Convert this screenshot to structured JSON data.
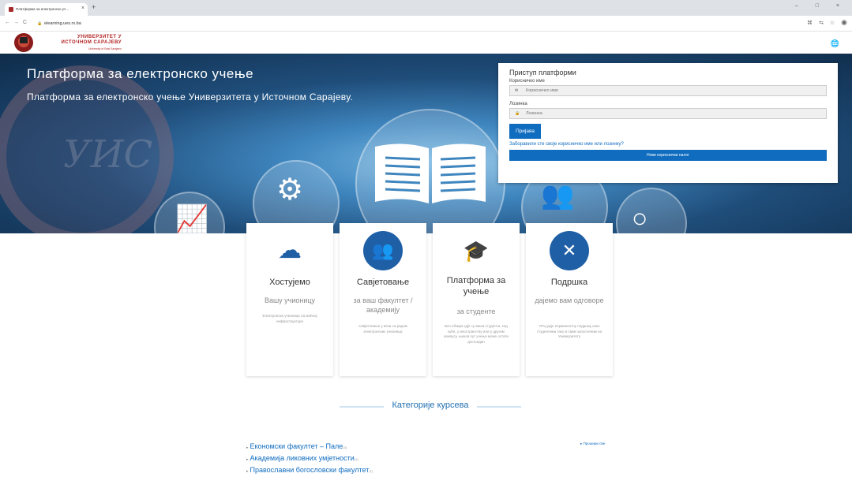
{
  "browser": {
    "tab_title": "Платформа за електронско уч...",
    "tab_close": "×",
    "new_tab": "+",
    "url": "elearning.ues.rs.ba",
    "back": "←",
    "forward": "→",
    "reload": "C",
    "window_controls": "– □ ×"
  },
  "header": {
    "logo_line1": "УНИВЕРЗИТЕТ У",
    "logo_line2": "ИСТОЧНОМ САРАЈЕВУ",
    "logo_line3": "University of East Sarajevo"
  },
  "hero": {
    "title": "Платформа за електронско учење",
    "subtitle": "Платформа за електронско учење Универзитета у Источном Сарајеву."
  },
  "login": {
    "heading": "Приступ платформи",
    "username_label": "Корисничко име",
    "username_placeholder": "Корисничко име",
    "password_label": "Лозинка",
    "password_placeholder": "Лозинка",
    "login_button": "Пријава",
    "forgot_link": "Заборавили сте своје корисничко име или лозинку?",
    "new_account_button": "Нови кориснички налог"
  },
  "cards": [
    {
      "title": "Хостујемо",
      "subtitle": "Вашу учионицу",
      "description": "Електронски учионице на моћној инфраструктури"
    },
    {
      "title": "Савјетовање",
      "subtitle": "за ваш факултет / академију",
      "description": "Савјетовање у вези са радом електронских учионица"
    },
    {
      "title": "Платформа за учење",
      "subtitle": "за студенте",
      "description": "Без обзира гдје су ваши студенти, код куће, у иностранству или у другим кампусу, њихов пут учења може остати досљедан"
    },
    {
      "title": "Подршка",
      "subtitle": "дајемо вам одговоре",
      "description": "УРЦ даје перманентну подршку како студентима тако и свим запосленим на Универзитету"
    }
  ],
  "categories": {
    "heading": "Категорије курсева",
    "expand_all": "Прошири све",
    "items": [
      {
        "label": "Економски факултет – Пале",
        "count": "(3)"
      },
      {
        "label": "Академија ликовних умјетности",
        "count": "(1)"
      },
      {
        "label": "Православни богословски факултет",
        "count": "(1)"
      }
    ]
  }
}
